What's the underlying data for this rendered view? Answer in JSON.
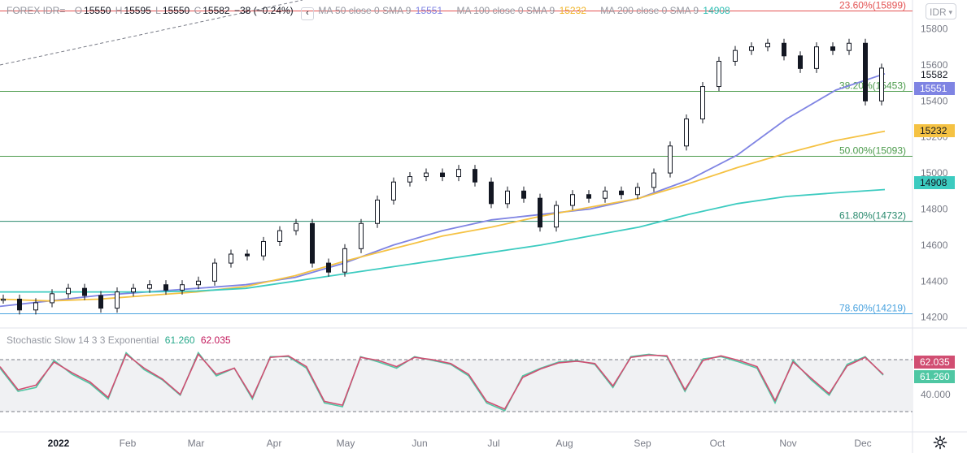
{
  "header": {
    "symbol": "FOREX IDR=",
    "open_label": "O",
    "open": "15550",
    "high_label": "H",
    "high": "15595",
    "low_label": "L",
    "low": "15550",
    "close_label": "C",
    "close": "15582",
    "change": "−38 (−0.24%)",
    "collapse_glyph": "‹",
    "currency": "IDR",
    "currency_caret": "▾"
  },
  "indicators": [
    {
      "label": "MA 50 close 0 SMA 9",
      "value": "15551",
      "color": "#7f84e3"
    },
    {
      "label": "MA 100 close 0 SMA 9",
      "value": "15232",
      "color": "#f5c243"
    },
    {
      "label": "MA 200 close 0 SMA 9",
      "value": "14908",
      "color": "#3ccbc0"
    }
  ],
  "stochastic": {
    "label": "Stochastic Slow 14 3 3 Exponential",
    "k_value": "61.260",
    "d_value": "62.035",
    "k_color": "#4fc7a3",
    "d_color": "#d14e72",
    "y_tick": "40.000",
    "k_badge": "61.260",
    "d_badge": "62.035"
  },
  "colors": {
    "candle": "#131722",
    "fib_red": "#e35353",
    "fib_green": "#4c9b4c",
    "fib_teal": "#2a8a6e",
    "fib_blue": "#4aa3df",
    "price_badge": "#131722"
  },
  "chart_data": {
    "type": "candlestick",
    "ylim": [
      14140,
      15960
    ],
    "y_ticks": [
      14200,
      14400,
      14600,
      14800,
      15000,
      15200,
      15400,
      15600,
      15800
    ],
    "y_tick_labels": [
      "14200",
      "14400",
      "14600",
      "14800",
      "15000",
      "15200",
      "15400",
      "15600",
      "15800"
    ],
    "x_tick_labels": [
      "2022",
      "Feb",
      "Mar",
      "Apr",
      "May",
      "Jun",
      "Jul",
      "Aug",
      "Sep",
      "Oct",
      "Nov",
      "Dec"
    ],
    "price_labels": {
      "last": "15582",
      "ma50": "15551",
      "ma100": "15232",
      "ma200": "14908"
    },
    "fib_levels": [
      {
        "label": "23.60%(15899)",
        "value": 15899
      },
      {
        "label": "38.20%(15453)",
        "value": 15453
      },
      {
        "label": "50.00%(15093)",
        "value": 15093
      },
      {
        "label": "61.80%(14732)",
        "value": 14732
      },
      {
        "label": "78.60%(14219)",
        "value": 14219
      }
    ],
    "series": [
      {
        "name": "MA 50",
        "values": [
          14260,
          14290,
          14320,
          14340,
          14360,
          14380,
          14420,
          14500,
          14600,
          14680,
          14740,
          14770,
          14800,
          14860,
          14960,
          15100,
          15300,
          15460,
          15551
        ]
      },
      {
        "name": "MA 100",
        "values": [
          14300,
          14290,
          14300,
          14320,
          14340,
          14370,
          14430,
          14510,
          14580,
          14650,
          14700,
          14760,
          14810,
          14860,
          14940,
          15030,
          15110,
          15180,
          15232
        ]
      },
      {
        "name": "MA 200",
        "values": [
          14340,
          14340,
          14340,
          14340,
          14345,
          14360,
          14400,
          14440,
          14480,
          14520,
          14560,
          14600,
          14650,
          14700,
          14770,
          14830,
          14870,
          14890,
          14908
        ]
      },
      {
        "name": "Close",
        "values": [
          14300,
          14240,
          14280,
          14330,
          14360,
          14320,
          14250,
          14340,
          14360,
          14380,
          14350,
          14380,
          14400,
          14500,
          14550,
          14540,
          14620,
          14680,
          14720,
          14500,
          14450,
          14580,
          14720,
          14850,
          14950,
          14980,
          15000,
          14980,
          15020,
          14950,
          14830,
          14900,
          14860,
          14700,
          14820,
          14880,
          14860,
          14900,
          14880,
          14920,
          15000,
          15150,
          15300,
          15480,
          15620,
          15680,
          15700,
          15720,
          15650,
          15580,
          15700,
          15680,
          15720,
          15400,
          15582
        ]
      },
      {
        "name": "Stochastic %K",
        "values": [
          70,
          40,
          45,
          80,
          62,
          50,
          30,
          90,
          68,
          55,
          35,
          90,
          60,
          70,
          30,
          85,
          85,
          70,
          25,
          20,
          85,
          78,
          70,
          85,
          80,
          75,
          60,
          25,
          15,
          60,
          70,
          78,
          80,
          75,
          45,
          85,
          88,
          85,
          40,
          82,
          85,
          78,
          70,
          25,
          80,
          55,
          35,
          75,
          85,
          61
        ]
      },
      {
        "name": "Stochastic %D",
        "values": [
          72,
          42,
          48,
          78,
          64,
          52,
          32,
          88,
          70,
          56,
          36,
          88,
          62,
          70,
          32,
          84,
          86,
          72,
          27,
          22,
          84,
          80,
          72,
          84,
          81,
          76,
          62,
          27,
          17,
          58,
          69,
          77,
          79,
          76,
          47,
          84,
          87,
          86,
          42,
          80,
          86,
          80,
          72,
          28,
          78,
          57,
          37,
          73,
          84,
          62
        ]
      }
    ]
  }
}
